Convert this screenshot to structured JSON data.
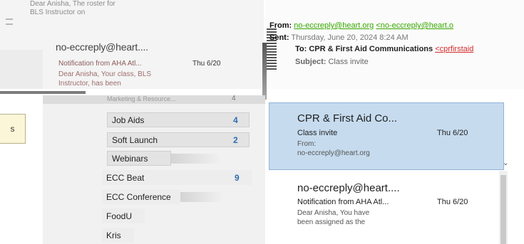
{
  "background_list": {
    "top_preview_line1": "Dear Anisha, The roster for",
    "top_preview_line2": "BLS Instructor on",
    "item": {
      "sender": "no-eccreply@heart....",
      "subject": "Notification from AHA Atl...",
      "date": "Thu 6/20",
      "preview_line1": "Dear Anisha, Your class, BLS",
      "preview_line2": "Instructor, has been"
    }
  },
  "reading_pane": {
    "from_label": "From:",
    "from_address": "no-eccreply@heart.org",
    "from_address_bracket": "<no-eccreply@heart.o",
    "sent_label": "Sent:",
    "sent_value": "Thursday, June 20, 2024 8:24 AM",
    "to_label": "To:",
    "to_value": "CPR & First Aid Communications",
    "to_address": "<cprfirstaid",
    "subject_label": "Subject:",
    "subject_value": "Class invite"
  },
  "left_button": {
    "label": "s"
  },
  "folders": {
    "partial_top": {
      "label": "Marketing & Resource...",
      "count": "4"
    },
    "items": [
      {
        "label": "Job Aids",
        "count": "4",
        "level": "sub"
      },
      {
        "label": "Soft Launch",
        "count": "2",
        "level": "sub"
      },
      {
        "label": "Webinars",
        "count": "",
        "level": "sub"
      },
      {
        "label": "ECC Beat",
        "count": "9",
        "level": "top"
      },
      {
        "label": "ECC Conference",
        "count": "",
        "level": "top"
      },
      {
        "label": "FoodU",
        "count": "",
        "level": "top"
      },
      {
        "label": "Kris",
        "count": "",
        "level": "top"
      }
    ]
  },
  "messages": [
    {
      "sender": "CPR & First Aid Co...",
      "subject": "Class invite",
      "date": "Thu 6/20",
      "line3": "From:",
      "line4": "no-eccreply@heart.org",
      "selected": true
    },
    {
      "sender": "no-eccreply@heart....",
      "subject": "Notification from AHA Atl...",
      "date": "Thu 6/20",
      "line3": "Dear Anisha, You have",
      "line4": "been assigned as the",
      "selected": false
    }
  ],
  "colors": {
    "selection": "#c6dbee",
    "link_green": "#38a800",
    "link_red": "#d42a2a",
    "folder_count": "#2f6db3"
  }
}
